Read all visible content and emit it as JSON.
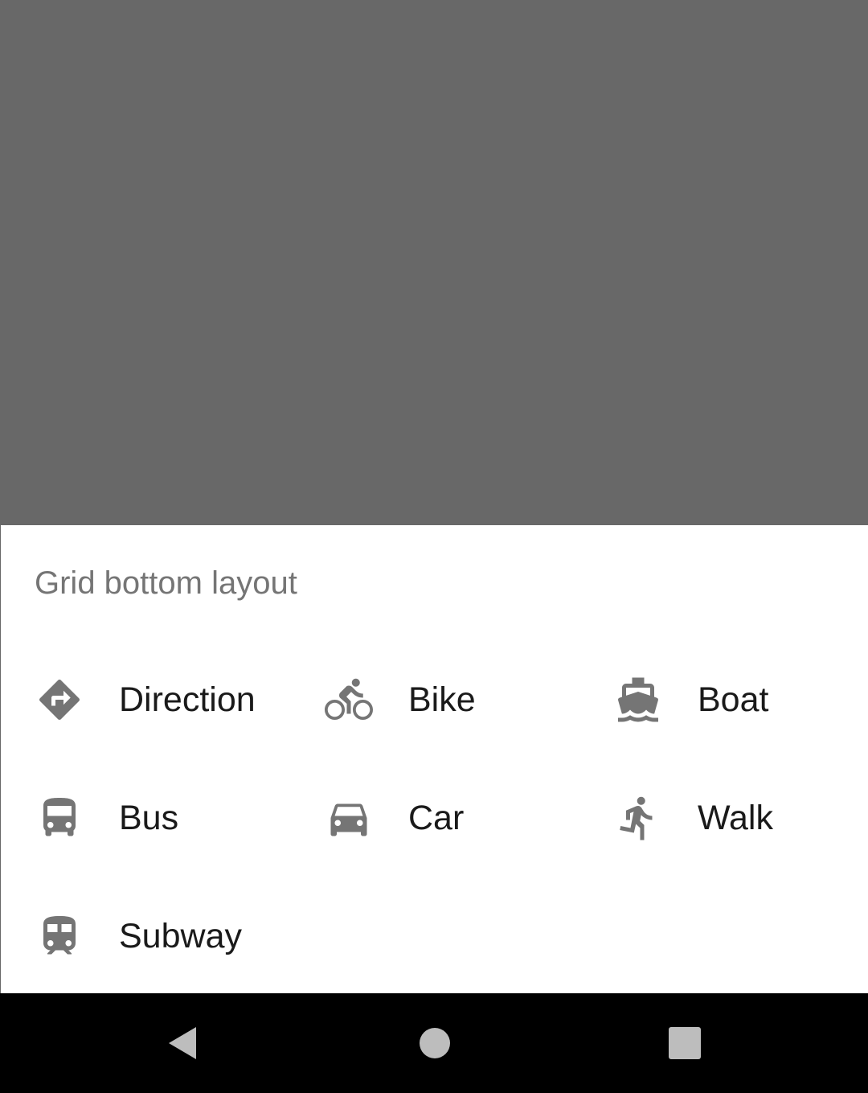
{
  "sheet": {
    "title": "Grid bottom layout",
    "items": [
      {
        "label": "Direction",
        "icon": "directions-icon"
      },
      {
        "label": "Bike",
        "icon": "bike-icon"
      },
      {
        "label": "Boat",
        "icon": "boat-icon"
      },
      {
        "label": "Bus",
        "icon": "bus-icon"
      },
      {
        "label": "Car",
        "icon": "car-icon"
      },
      {
        "label": "Walk",
        "icon": "walk-icon"
      },
      {
        "label": "Subway",
        "icon": "subway-icon"
      }
    ]
  },
  "colors": {
    "scrim": "#686868",
    "sheet_background": "#ffffff",
    "title_text": "#757575",
    "item_text": "#1a1a1a",
    "icon": "#757575",
    "navbar": "#000000",
    "nav_icons": "#bdbdbd"
  },
  "navbar": {
    "buttons": [
      "back-icon",
      "home-icon",
      "recents-icon"
    ]
  }
}
